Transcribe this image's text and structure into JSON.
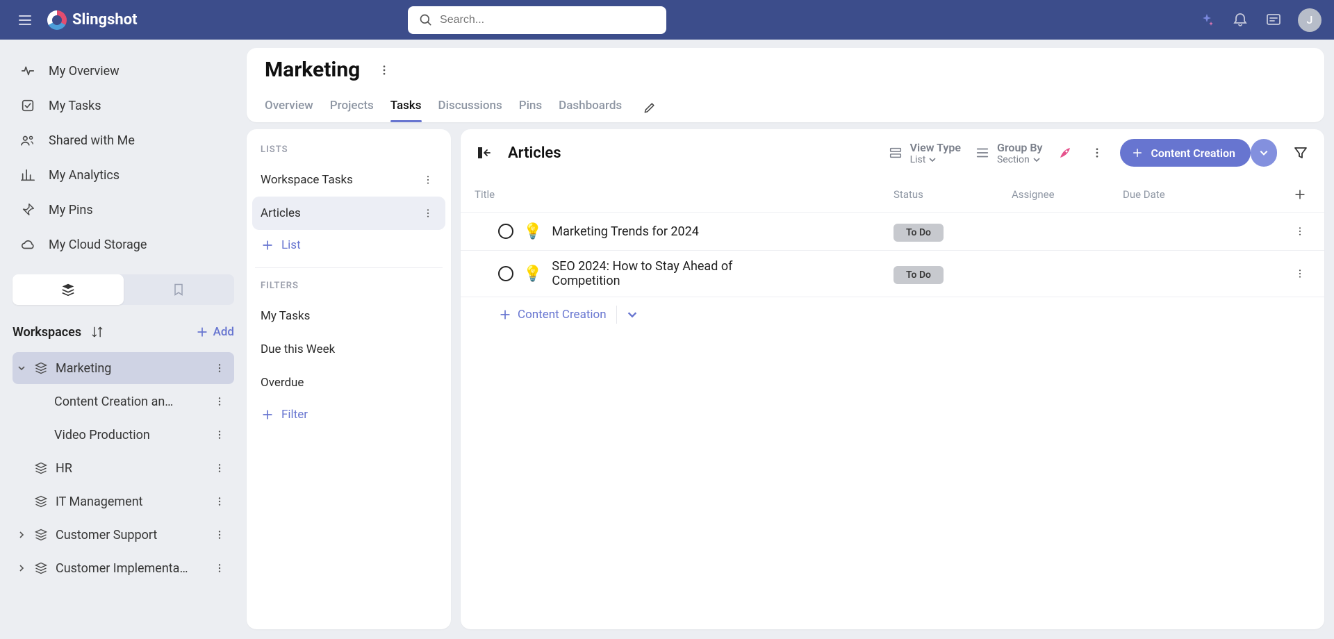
{
  "app_name": "Slingshot",
  "search": {
    "placeholder": "Search..."
  },
  "avatar_initial": "J",
  "sidebar": {
    "items": [
      {
        "label": "My Overview"
      },
      {
        "label": "My Tasks"
      },
      {
        "label": "Shared with Me"
      },
      {
        "label": "My Analytics"
      },
      {
        "label": "My Pins"
      },
      {
        "label": "My Cloud Storage"
      }
    ]
  },
  "workspaces": {
    "heading": "Workspaces",
    "add_label": "Add",
    "list": [
      {
        "label": "Marketing",
        "active": true,
        "children": [
          {
            "label": "Content Creation an…"
          },
          {
            "label": "Video Production"
          }
        ]
      },
      {
        "label": "HR"
      },
      {
        "label": "IT Management"
      },
      {
        "label": "Customer Support",
        "has_children": true
      },
      {
        "label": "Customer Implementa…",
        "has_children": true
      }
    ]
  },
  "page": {
    "title": "Marketing"
  },
  "tabs": [
    {
      "label": "Overview"
    },
    {
      "label": "Projects"
    },
    {
      "label": "Tasks",
      "active": true
    },
    {
      "label": "Discussions"
    },
    {
      "label": "Pins"
    },
    {
      "label": "Dashboards"
    }
  ],
  "lists_panel": {
    "heading": "LISTS",
    "items": [
      {
        "label": "Workspace Tasks"
      },
      {
        "label": "Articles",
        "active": true
      }
    ],
    "add_label": "List",
    "filters_heading": "FILTERS",
    "filters": [
      {
        "label": "My Tasks"
      },
      {
        "label": "Due this Week"
      },
      {
        "label": "Overdue"
      }
    ],
    "add_filter_label": "Filter"
  },
  "main_panel": {
    "title": "Articles",
    "view_type": {
      "label": "View Type",
      "value": "List"
    },
    "group_by": {
      "label": "Group By",
      "value": "Section"
    },
    "primary_button": "Content Creation",
    "columns": [
      "Title",
      "Status",
      "Assignee",
      "Due Date"
    ],
    "tasks": [
      {
        "title": "Marketing Trends for 2024",
        "status": "To Do"
      },
      {
        "title": "SEO 2024: How to Stay Ahead of Competition",
        "status": "To Do"
      }
    ],
    "section_add_label": "Content Creation"
  }
}
